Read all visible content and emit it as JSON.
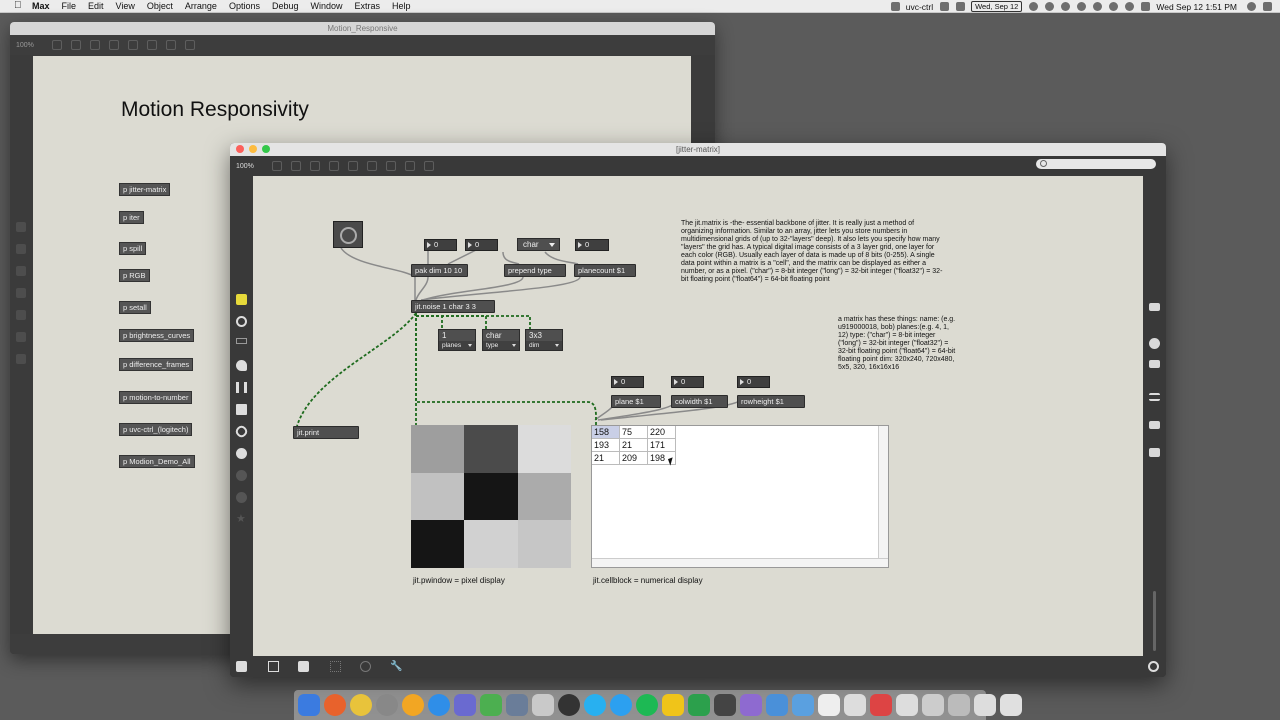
{
  "menubar": {
    "app": "Max",
    "items": [
      "File",
      "Edit",
      "View",
      "Object",
      "Arrange",
      "Options",
      "Debug",
      "Window",
      "Extras",
      "Help"
    ],
    "status": {
      "uvc_label": "uvc-ctrl",
      "date_badge": "Wed, Sep 12",
      "clock": "Wed Sep 12  1:51 PM"
    }
  },
  "back_window": {
    "title": "Motion_Responsive",
    "zoom": "100%",
    "heading": "Motion Responsivity",
    "patchers": [
      "p jitter-matrix",
      "p iter",
      "p spill",
      "p RGB",
      "p setall",
      "p brightness_curves",
      "p difference_frames",
      "p motion-to-number",
      "p uvc-ctrl_(logitech)",
      "p Modion_Demo_All"
    ]
  },
  "front_window": {
    "title": "[jitter-matrix]",
    "zoom": "100%",
    "objects": {
      "num1": "0",
      "num2": "0",
      "char_menu": "char",
      "num3": "0",
      "pak": "pak dim 10 10",
      "prepend": "prepend type",
      "planecount": "planecount $1",
      "noise": "jit.noise 1 char 3 3",
      "print": "jit.print",
      "num_plane": "0",
      "num_colwidth": "0",
      "num_rowheight": "0",
      "plane_msg": "plane $1",
      "colwidth_msg": "colwidth $1",
      "rowheight_msg": "rowheight $1"
    },
    "attrui": [
      {
        "value": "1",
        "label": "planes"
      },
      {
        "value": "char",
        "label": "type"
      },
      {
        "value": "3x3",
        "label": "dim"
      }
    ],
    "comment_main": "The jit.matrix is -the- essential backbone of jitter. It is really just a method of organizing information. Similar to an array, jitter lets you store numbers in multidimensional grids of (up to 32-\"layers\" deep). It also lets you specify how many \"layers\" the grid has. A typical digital image consists of a 3 layer grid, one layer for each color (RGB). Usually each layer of data is made up of 8 bits (0-255). A single data point within a matrix is a \"cell\", and the matrix can be displayed as either a number, or as a pixel. (\"char\") = 8-bit integer (\"long\") = 32-bit integer (\"float32\") = 32-bit floating point (\"float64\") = 64-bit floating point",
    "comment_attrs": "a matrix has these things: name: (e.g. u919000018, bob) planes:(e.g. 4, 1, 12) type: (\"char\") = 8-bit integer (\"long\") = 32-bit integer (\"float32\") = 32-bit floating point (\"float64\") = 64-bit floating point dim: 320x240, 720x480, 5x5, 320, 16x16x16",
    "pwindow_label": "jit.pwindow = pixel display",
    "cellblock_label": "jit.cellblock = numerical display",
    "pixel_gray_values": [
      158,
      75,
      220,
      193,
      21,
      171,
      21,
      209,
      198
    ],
    "cell_rows": [
      [
        "158",
        "75",
        "220"
      ],
      [
        "193",
        "21",
        "171"
      ],
      [
        "21",
        "209",
        "198"
      ]
    ]
  }
}
